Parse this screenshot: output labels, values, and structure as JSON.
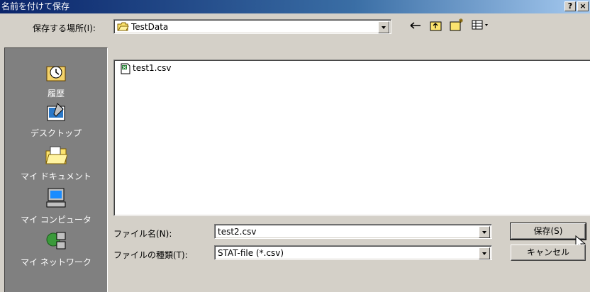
{
  "window": {
    "title": "名前を付けて保存",
    "help_label": "?",
    "close_label": "×"
  },
  "location": {
    "label": "保存する場所(I):",
    "value": "TestData"
  },
  "toolbar": {
    "back_icon": "back-arrow-icon",
    "up_icon": "up-folder-icon",
    "new_folder_icon": "new-folder-icon",
    "view_icon": "view-menu-icon"
  },
  "places": [
    {
      "label": "履歴",
      "icon": "history-icon"
    },
    {
      "label": "デスクトップ",
      "icon": "desktop-icon"
    },
    {
      "label": "マイ ドキュメント",
      "icon": "my-documents-icon"
    },
    {
      "label": "マイ コンピュータ",
      "icon": "my-computer-icon"
    },
    {
      "label": "マイ ネットワーク",
      "icon": "my-network-icon"
    }
  ],
  "files": [
    {
      "name": "test1.csv",
      "icon": "csv-file-icon"
    }
  ],
  "filename": {
    "label": "ファイル名(N):",
    "value": "test2.csv"
  },
  "filetype": {
    "label": "ファイルの種類(T):",
    "value": "STAT-file (*.csv)"
  },
  "buttons": {
    "save": "保存(S)",
    "cancel": "キャンセル"
  },
  "colors": {
    "title_start": "#0a246a",
    "title_end": "#a6caf0",
    "face": "#d4d0c8",
    "places_bg": "#808080"
  }
}
